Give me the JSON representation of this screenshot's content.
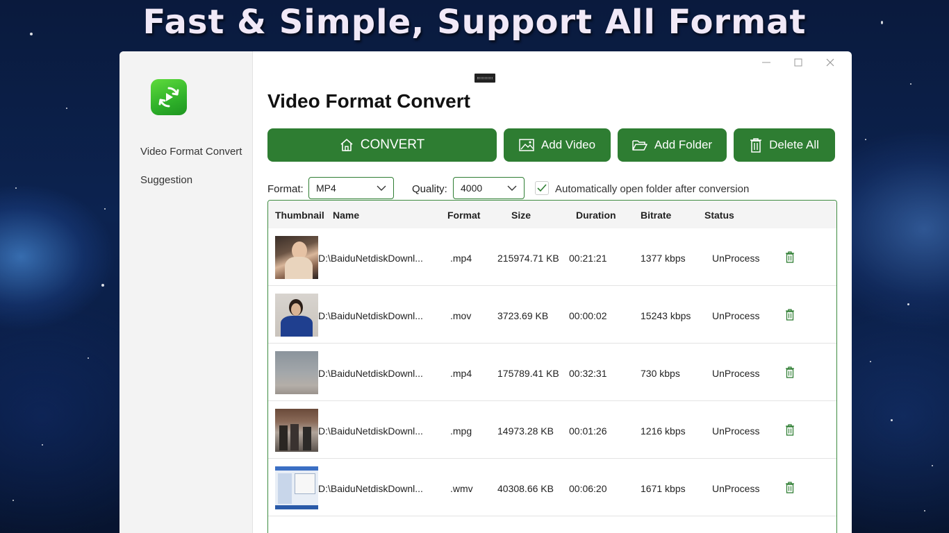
{
  "headline": "Fast & Simple, Support All Format",
  "sidebar": {
    "items": [
      {
        "label": "Video Format Convert"
      },
      {
        "label": "Suggestion"
      }
    ]
  },
  "main": {
    "title": "Video Format Convert"
  },
  "toolbar": {
    "convert_label": "CONVERT",
    "add_video_label": "Add Video",
    "add_folder_label": "Add Folder",
    "delete_all_label": "Delete All"
  },
  "options": {
    "format_label": "Format:",
    "format_value": "MP4",
    "quality_label": "Quality:",
    "quality_value": "4000",
    "auto_open_label": "Automatically open folder after conversion",
    "auto_open_checked": true
  },
  "table": {
    "columns": [
      "Thumbnail",
      "Name",
      "Format",
      "Size",
      "Duration",
      "Bitrate",
      "Status"
    ],
    "rows": [
      {
        "name": "D:\\BaiduNetdiskDownl...",
        "format": ".mp4",
        "size": "215974.71 KB",
        "duration": "00:21:21",
        "bitrate": "1377 kbps",
        "status": "UnProcess",
        "thumb": "person-portrait"
      },
      {
        "name": "D:\\BaiduNetdiskDownl...",
        "format": ".mov",
        "size": "3723.69 KB",
        "duration": "00:00:02",
        "bitrate": "15243 kbps",
        "status": "UnProcess",
        "thumb": "person-blue-shirt"
      },
      {
        "name": "D:\\BaiduNetdiskDownl...",
        "format": ".mp4",
        "size": "175789.41 KB",
        "duration": "00:32:31",
        "bitrate": "730 kbps",
        "status": "UnProcess",
        "thumb": "sky"
      },
      {
        "name": "D:\\BaiduNetdiskDownl...",
        "format": ".mpg",
        "size": "14973.28 KB",
        "duration": "00:01:26",
        "bitrate": "1216 kbps",
        "status": "UnProcess",
        "thumb": "street-scene"
      },
      {
        "name": "D:\\BaiduNetdiskDownl...",
        "format": ".wmv",
        "size": "40308.66 KB",
        "duration": "00:06:20",
        "bitrate": "1671 kbps",
        "status": "UnProcess",
        "thumb": "desktop-screenshot"
      }
    ]
  },
  "colors": {
    "accent": "#2e7d32",
    "sidebar_bg": "#f3f3f3"
  },
  "icons": [
    "home-icon",
    "image-icon",
    "folder-open-icon",
    "trash-icon",
    "chevron-down-icon",
    "check-icon",
    "minimize-icon",
    "maximize-icon",
    "close-icon",
    "convert-logo-icon"
  ]
}
